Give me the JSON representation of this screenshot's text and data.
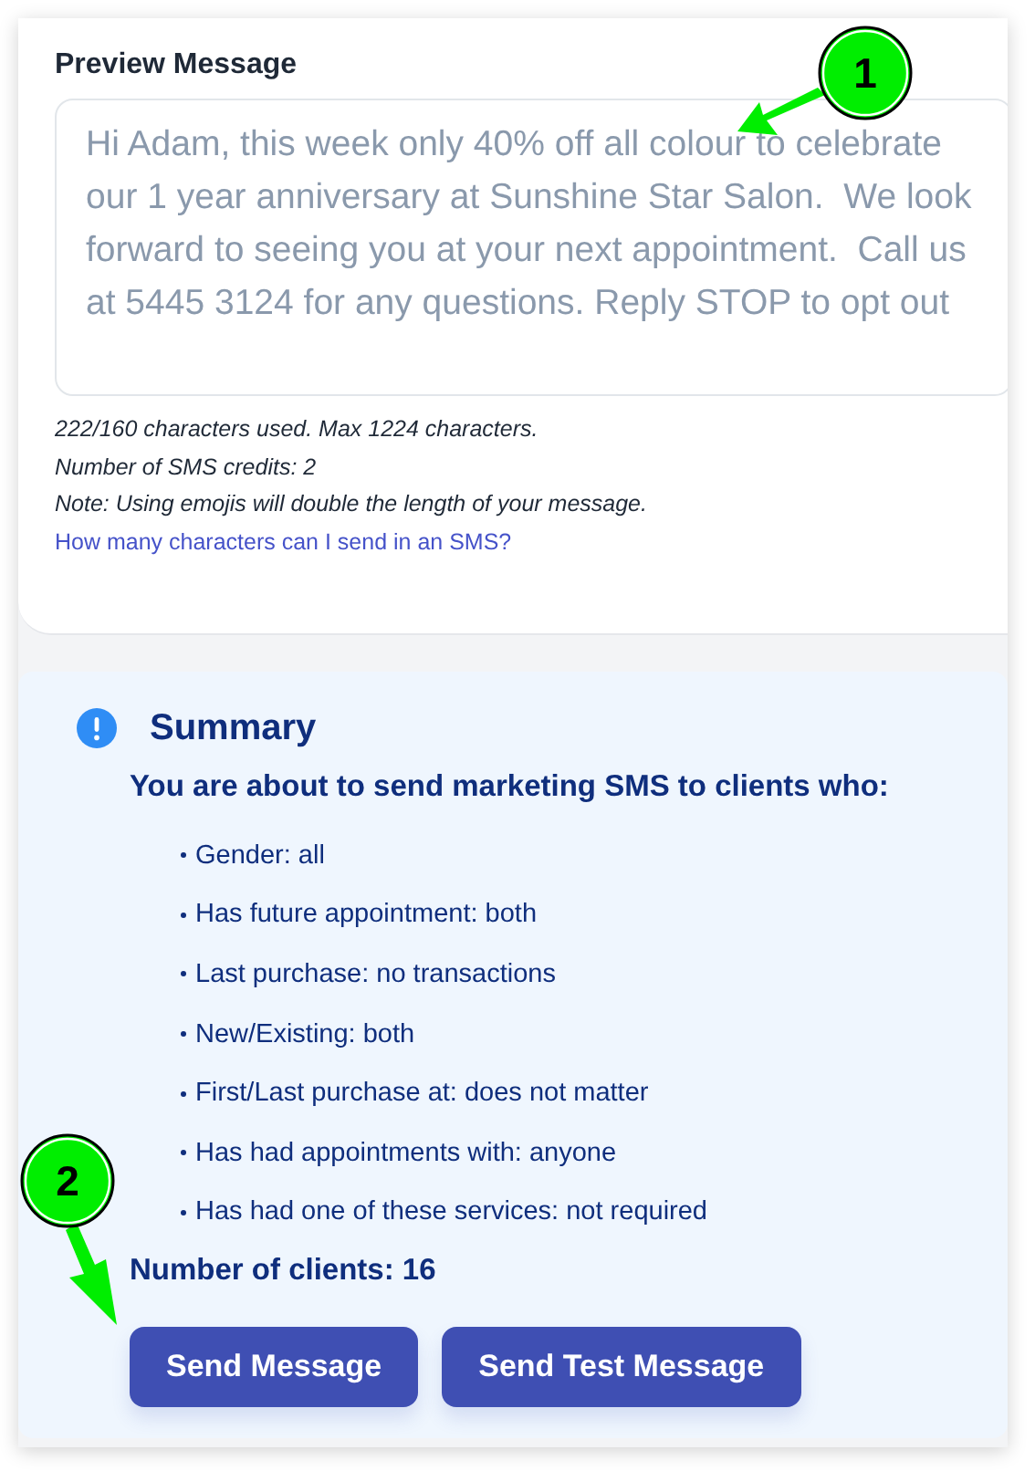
{
  "preview": {
    "title": "Preview Message",
    "message": "Hi Adam, this week only 40% off all colour to celebrate our 1 year anniversary at Sunshine Star Salon.  We look forward to seeing you at your next appointment.  Call us at 5445 3124 for any questions. Reply STOP to opt out",
    "notes": [
      "222/160 characters used. Max 1224 characters.",
      "Number of SMS credits: 2",
      "Note: Using emojis will double the length of your message."
    ],
    "help_link": "How many characters can I send in an SMS?"
  },
  "summary": {
    "title": "Summary",
    "subtitle": "You are about to send marketing SMS to clients who:",
    "criteria": [
      "Gender: all",
      "Has future appointment: both",
      "Last purchase: no transactions",
      "New/Existing: both",
      "First/Last purchase at: does not matter",
      "Has had appointments with: anyone",
      "Has had one of these services: not required"
    ],
    "client_count": "Number of clients: 16"
  },
  "buttons": [
    "Send Message",
    "Send Test Message"
  ],
  "callouts": [
    {
      "number": "1"
    },
    {
      "number": "2"
    }
  ]
}
